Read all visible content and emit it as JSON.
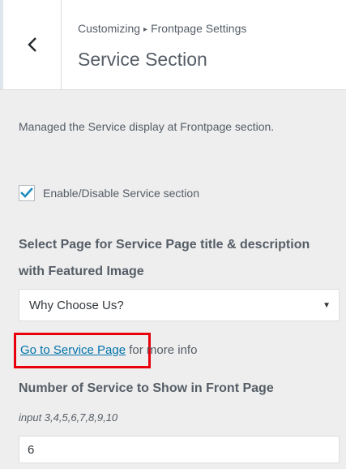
{
  "header": {
    "breadcrumb_root": "Customizing",
    "breadcrumb_separator": "▸",
    "breadcrumb_parent": "Frontpage Settings",
    "title": "Service Section",
    "back_icon": "chevron-left-icon"
  },
  "section": {
    "description": "Managed the Service display at Frontpage section.",
    "enable_checkbox": {
      "label": "Enable/Disable Service section",
      "checked": true,
      "check_color": "#1e8cbe"
    },
    "page_select": {
      "title": "Select Page for Service Page title & description with Featured Image",
      "selected": "Why Choose Us?",
      "arrow": "▼"
    },
    "service_link": {
      "link_text": "Go to Service Page",
      "suffix_text": " for more info",
      "highlight_color": "#e8000d"
    },
    "number_field": {
      "title": "Number of Service to Show in Front Page",
      "hint": "input 3,4,5,6,7,8,9,10",
      "value": "6"
    }
  },
  "colors": {
    "link": "#0073aa",
    "panel_background": "#eeeeee",
    "header_background": "#ffffff"
  }
}
